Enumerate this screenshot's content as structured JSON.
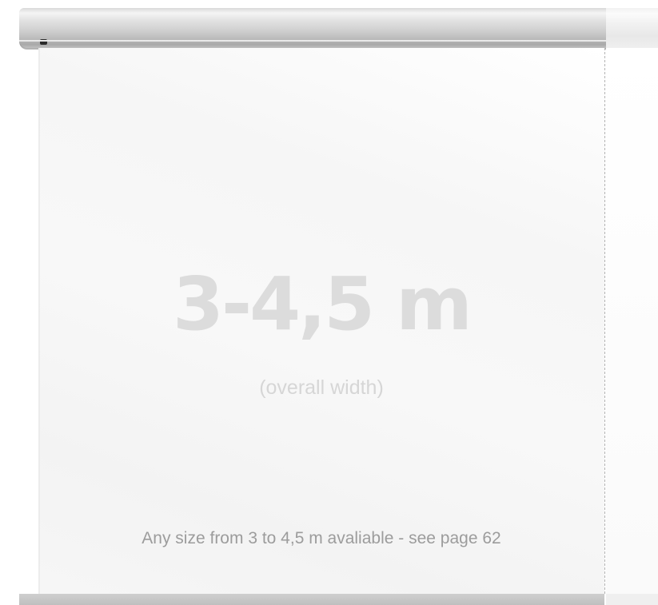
{
  "screen": {
    "size_range": "3-4,5 m",
    "size_caption": "(overall width)",
    "availability_note": "Any size from 3 to 4,5 m avaliable - see page 62"
  },
  "colors": {
    "roller": "#cfcfcf",
    "screen_surface": "#f6f6f6",
    "size_text": "#dcdcdc",
    "note_text": "#9c9c9c",
    "dashed_guide": "#b3b3b3"
  }
}
